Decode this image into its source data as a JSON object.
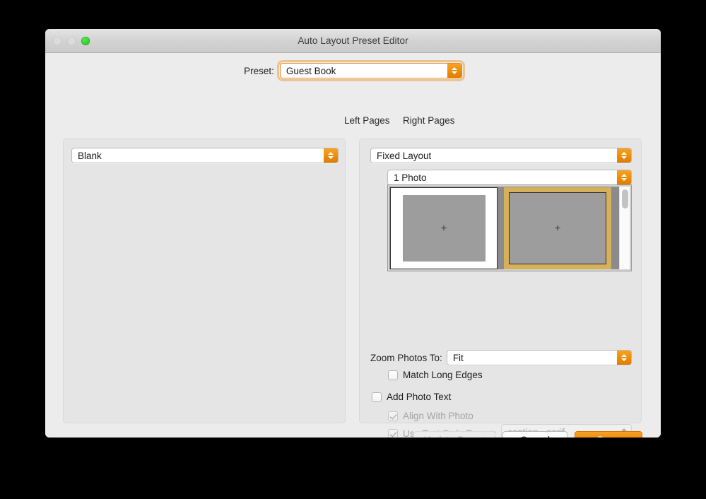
{
  "window": {
    "title": "Auto Layout Preset Editor",
    "traffic_lights": [
      {
        "name": "close",
        "state": "disabled"
      },
      {
        "name": "minimize",
        "state": "disabled"
      },
      {
        "name": "zoom",
        "state": "active",
        "color": "#30cf2b"
      }
    ]
  },
  "preset": {
    "label": "Preset:",
    "value": "Guest Book",
    "focused": true
  },
  "columns": {
    "left_label": "Left Pages",
    "right_label": "Right Pages"
  },
  "left_panel": {
    "page_type": "Blank"
  },
  "right_panel": {
    "layout_type": "Fixed Layout",
    "photo_count": "1 Photo",
    "layout_grid": {
      "cells": [
        {
          "index": 1,
          "style": "white-page-inset-photo",
          "placeholder": "+",
          "selected": false
        },
        {
          "index": 2,
          "style": "full-bleed-photo",
          "placeholder": "+",
          "selected": true
        },
        {
          "index": 3,
          "style": "photo-bottom-band",
          "placeholder": "",
          "selected": false
        },
        {
          "index": 4,
          "style": "text-lines",
          "placeholder": "",
          "selected": false
        }
      ],
      "selected_index": 2,
      "selection_color": "#d6b05a",
      "scroll_position": "top"
    },
    "zoom_photos": {
      "label": "Zoom Photos To:",
      "value": "Fit"
    },
    "match_long_edges": {
      "label": "Match Long Edges",
      "checked": false,
      "enabled": true
    },
    "add_photo_text": {
      "label": "Add Photo Text",
      "checked": false,
      "enabled": true
    },
    "align_with_photo": {
      "label": "Align With Photo",
      "checked": true,
      "enabled": false
    },
    "use_text_style_preset": {
      "label": "Use Text Style Preset:",
      "checked": true,
      "enabled": false,
      "value": "caption - serif"
    }
  },
  "footer": {
    "update_preset": {
      "label": "Update Preset",
      "enabled": false
    },
    "cancel": {
      "label": "Cancel",
      "enabled": true
    },
    "done": {
      "label": "Done",
      "enabled": true,
      "default": true,
      "color": "#ef8c09"
    }
  }
}
